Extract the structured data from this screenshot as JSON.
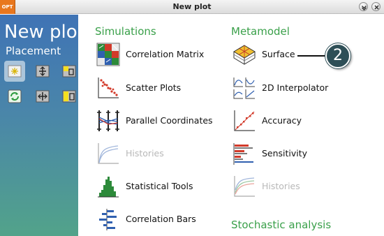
{
  "window": {
    "title": "New plot",
    "logo_text": "OPT"
  },
  "left_panel": {
    "title": "New plo",
    "placement_label": "Placement"
  },
  "sections": {
    "simulations": "Simulations",
    "metamodel": "Metamodel",
    "stochastic": "Stochastic analysis"
  },
  "simulations_items": [
    {
      "label": "Correlation Matrix",
      "enabled": true
    },
    {
      "label": "Scatter Plots",
      "enabled": true
    },
    {
      "label": "Parallel Coordinates",
      "enabled": true
    },
    {
      "label": "Histories",
      "enabled": false
    },
    {
      "label": "Statistical Tools",
      "enabled": true
    },
    {
      "label": "Correlation Bars",
      "enabled": true
    }
  ],
  "metamodel_items": [
    {
      "label": "Surface",
      "enabled": true
    },
    {
      "label": "2D Interpolator",
      "enabled": true
    },
    {
      "label": "Accuracy",
      "enabled": true
    },
    {
      "label": "Sensitivity",
      "enabled": true
    },
    {
      "label": "Histories",
      "enabled": false
    }
  ],
  "callout": {
    "number": "2"
  },
  "colors": {
    "section_heading": "#3aa04a",
    "disabled_text": "#b8b8b8",
    "callout_fill": "#2e4f57"
  }
}
